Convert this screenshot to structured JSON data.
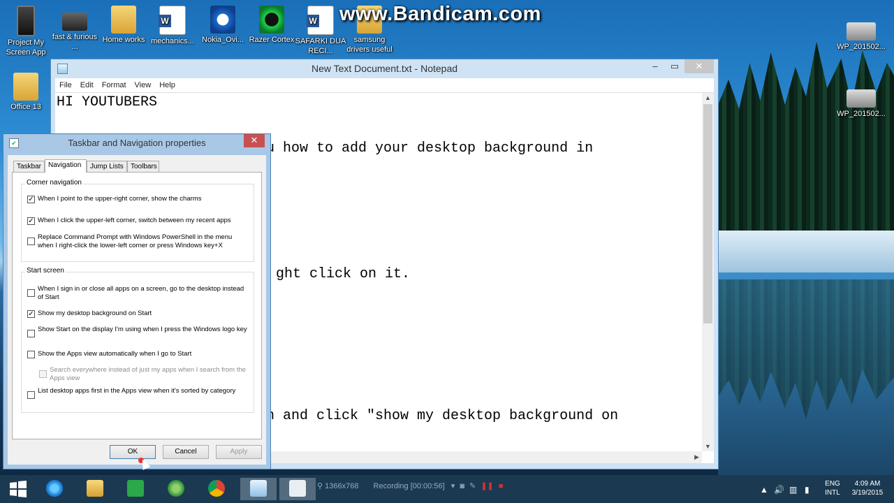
{
  "watermark": "www.Bandicam.com",
  "desktop_icons": [
    {
      "label": "Project My Screen App",
      "icon": "phone-icon"
    },
    {
      "label": "fast & furious ...",
      "icon": "car-icon"
    },
    {
      "label": "Home works",
      "icon": "folder-icon"
    },
    {
      "label": "mechanics...",
      "icon": "word-document-icon"
    },
    {
      "label": "Nokia_Ovi...",
      "icon": "nokia-ovi-icon"
    },
    {
      "label": "Razer Cortex",
      "icon": "razer-cortex-icon"
    },
    {
      "label": "SAFARKI DUA RECI...",
      "icon": "word-document-icon"
    },
    {
      "label": "samsung drivers useful",
      "icon": "folder-icon"
    },
    {
      "label": "Office 13",
      "icon": "folder-icon"
    },
    {
      "label": "WP_201502...",
      "icon": "image-icon"
    },
    {
      "label": "WP_201502...",
      "icon": "image-icon"
    }
  ],
  "notepad": {
    "title": "New Text Document.txt - Notepad",
    "menu": [
      "File",
      "Edit",
      "Format",
      "View",
      "Help"
    ],
    "lines": [
      "HI YOUTUBERS",
      "u how to add your desktop background in",
      "ght click on it.",
      "n and click \"show my desktop background on"
    ]
  },
  "dialog": {
    "title": "Taskbar and Navigation properties",
    "tabs": [
      "Taskbar",
      "Navigation",
      "Jump Lists",
      "Toolbars"
    ],
    "active_tab": "Navigation",
    "corner_group_label": "Corner navigation",
    "corner_options": [
      {
        "text": "When I point to the upper-right corner, show the charms",
        "checked": true
      },
      {
        "text": "When I click the upper-left corner, switch between my recent apps",
        "checked": true
      },
      {
        "text": "Replace Command Prompt with Windows PowerShell in the menu when I right-click the lower-left corner or press Windows key+X",
        "checked": false
      }
    ],
    "start_group_label": "Start screen",
    "start_options": [
      {
        "text": "When I sign in or close all apps on a screen, go to the desktop instead of Start",
        "checked": false
      },
      {
        "text": "Show my desktop background on Start",
        "checked": true
      },
      {
        "text": "Show Start on the display I'm using when I press the Windows logo key",
        "checked": false
      },
      {
        "text": "Show the Apps view automatically when I go to Start",
        "checked": false
      },
      {
        "text": "Search everywhere instead of just my apps when I search from the Apps view",
        "checked": false,
        "disabled": true
      },
      {
        "text": "List desktop apps first in the Apps view when it's sorted by category",
        "checked": false
      }
    ],
    "buttons": {
      "ok": "OK",
      "cancel": "Cancel",
      "apply": "Apply"
    }
  },
  "taskbar": {
    "recording_resolution": "1366x768",
    "recording_status": "Recording [00:00:56]",
    "language": "ENG",
    "keyboard": "INTL",
    "time": "4:09 AM",
    "date": "3/19/2015"
  },
  "colors": {
    "title_close": "#c75050",
    "taskbar": "#1b3a52",
    "dialog_frame": "#a9c8e6",
    "notepad_frame": "#cfe3f5"
  }
}
